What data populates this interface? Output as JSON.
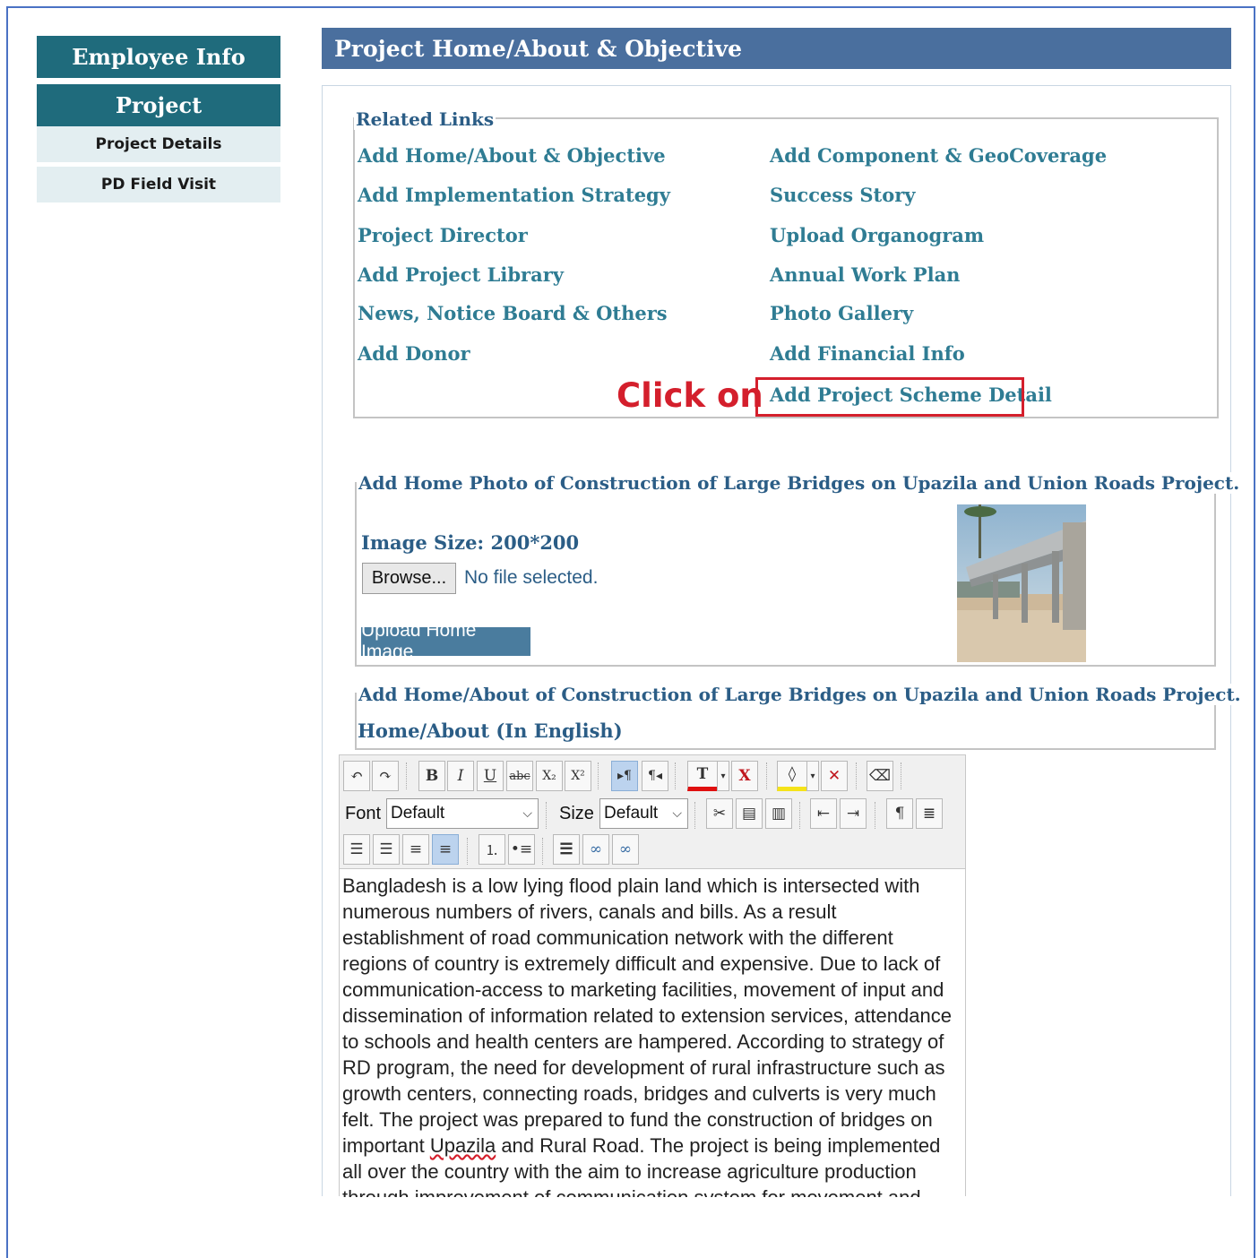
{
  "sidebar": {
    "employee_info": "Employee Info",
    "project": "Project",
    "items": [
      {
        "label": "Project Details"
      },
      {
        "label": "PD Field Visit"
      }
    ]
  },
  "header": {
    "title": "Project Home/About & Objective"
  },
  "related_links": {
    "legend": "Related Links",
    "left": [
      "Add Home/About & Objective",
      "Add Implementation Strategy",
      "Project Director",
      "Add Project Library",
      "News, Notice Board & Others",
      "Add Donor"
    ],
    "right": [
      "Add Component & GeoCoverage",
      "Success Story",
      "Upload Organogram",
      "Annual Work Plan",
      "Photo Gallery",
      "Add Financial Info",
      "Add Project Scheme Detail"
    ]
  },
  "annotation": {
    "text": "Click on"
  },
  "home_photo": {
    "legend": "Add Home Photo of Construction of Large Bridges on Upazila and Union Roads Project.",
    "image_size": "Image Size: 200*200",
    "browse_label": "Browse...",
    "no_file_text": "No file selected.",
    "upload_label": "Upload Home Image"
  },
  "home_about": {
    "legend": "Add Home/About of Construction of Large Bridges on Upazila and Union Roads Project.",
    "subheading": "Home/About (In English)"
  },
  "editor": {
    "font_label": "Font",
    "font_value": "Default",
    "size_label": "Size",
    "size_value": "Default",
    "body_before": "Bangladesh is a low lying flood plain land which is intersected with numerous numbers of rivers, canals and bills. As a result establishment of road communication network with the different regions of country is extremely difficult and expensive. Due to lack of communication-access to marketing facilities, movement of input and dissemination of information related to extension services, attendance to schools and health centers are hampered. According to strategy of RD program, the need for development of rural infrastructure such as growth centers, connecting roads, bridges and culverts is very much felt. The project was prepared to fund the construction of bridges on important ",
    "body_misspelled": "Upazila",
    "body_after": " and Rural Road. The project is being implemented all over the country with the aim to increase agriculture production through improvement of communication system for movement and timely"
  }
}
